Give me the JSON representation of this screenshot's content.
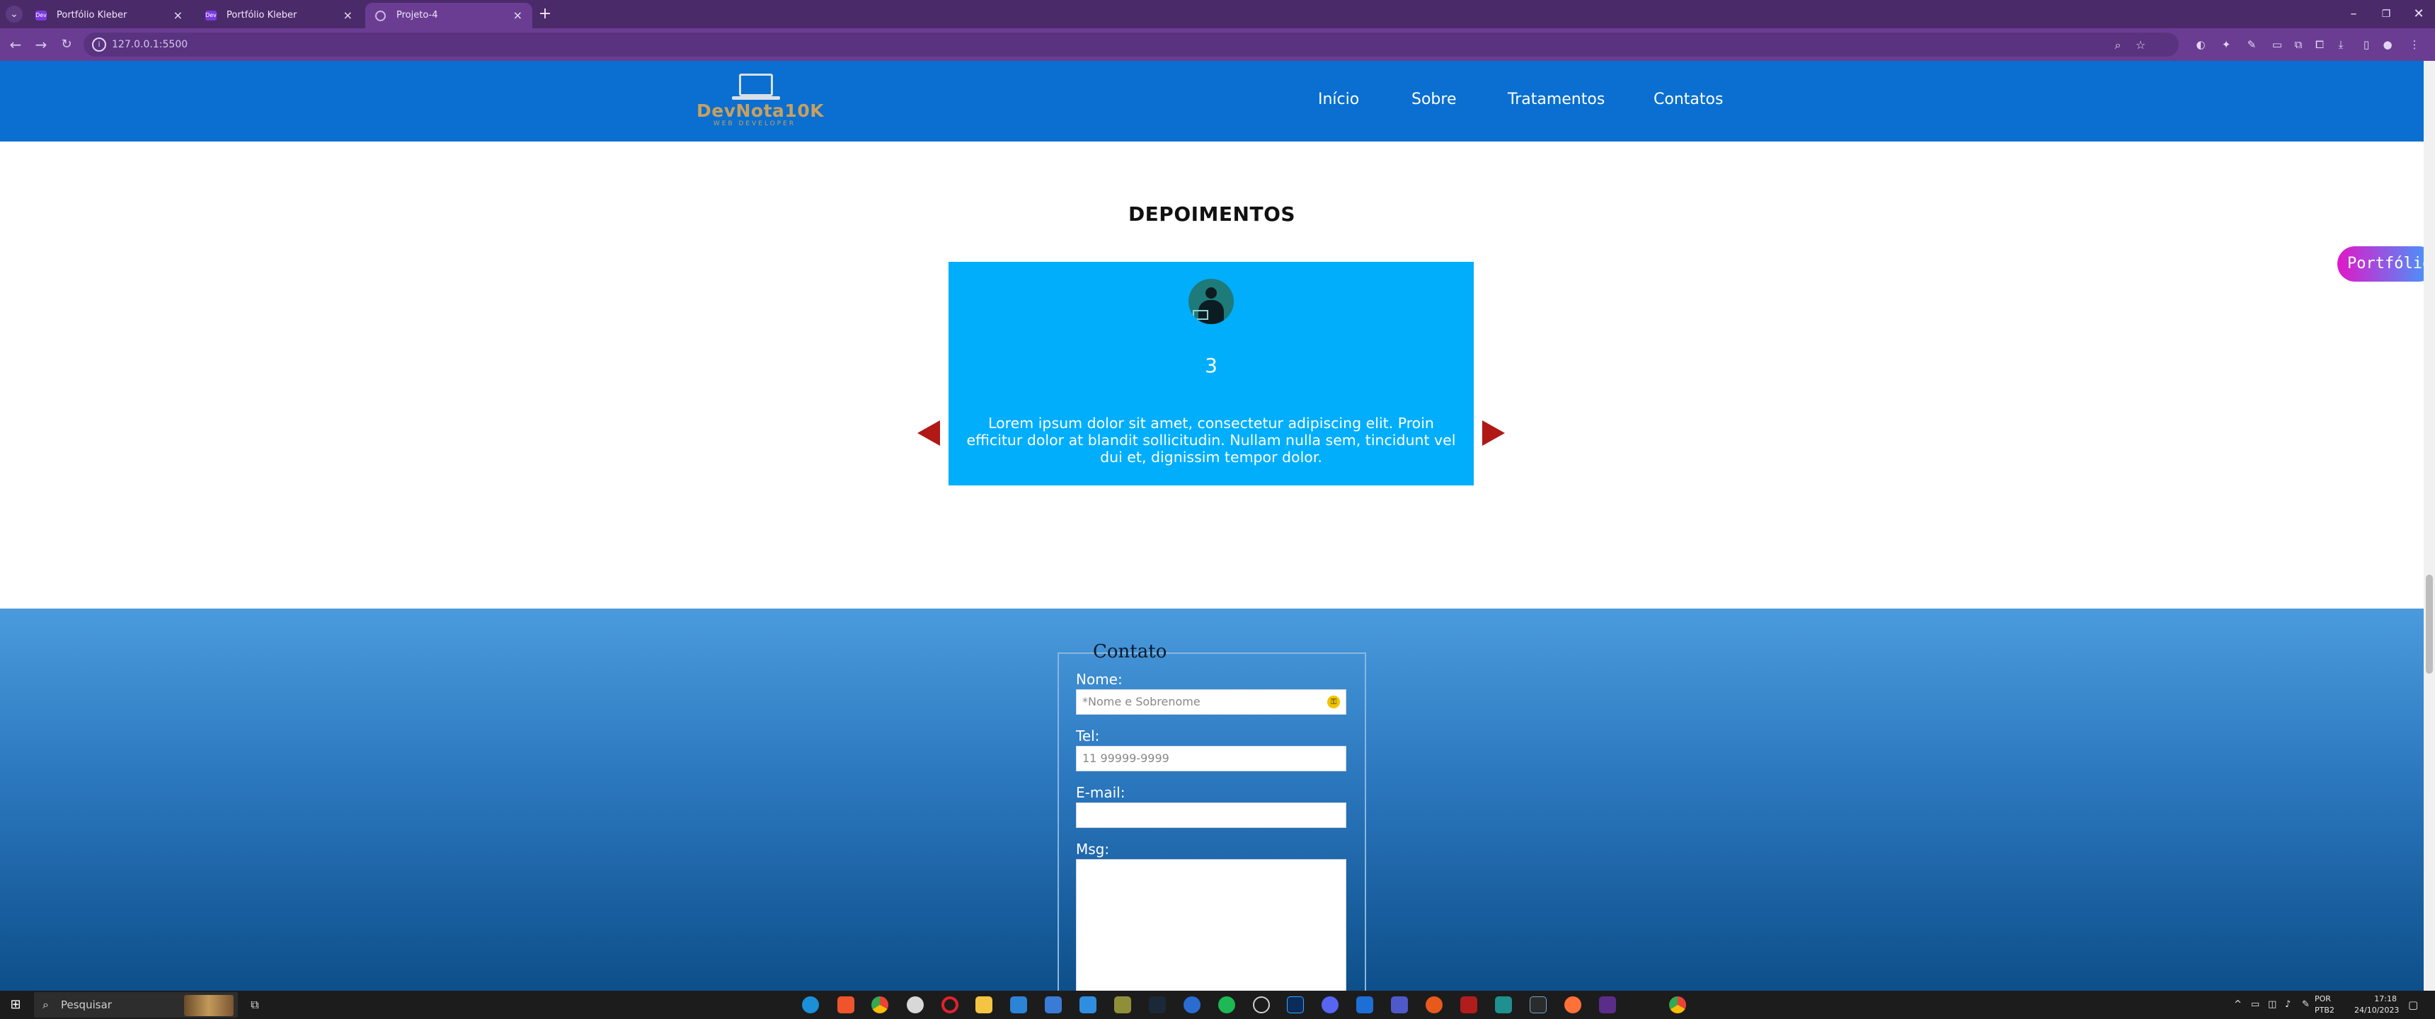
{
  "browser": {
    "tabs": [
      {
        "title": "Portfólio Kleber",
        "active": false
      },
      {
        "title": "Portfólio Kleber",
        "active": false
      },
      {
        "title": "Projeto-4",
        "active": true
      }
    ],
    "url": "127.0.0.1:5500"
  },
  "site": {
    "logo_text": "DevNota10K",
    "logo_tagline": "WEB DEVELOPER",
    "nav": [
      "Início",
      "Sobre",
      "Tratamentos",
      "Contatos"
    ]
  },
  "testimonials": {
    "title": "DEPOIMENTOS",
    "number": "3",
    "text": "Lorem ipsum dolor sit amet, consectetur adipiscing elit. Proin efficitur dolor at blandit sollicitudin. Nullam nulla sem, tincidunt vel dui et, dignissim tempor dolor.",
    "arrow_color": "#b01916",
    "card_color": "#00aefc"
  },
  "floating_button": {
    "label": "Portfólio"
  },
  "contact": {
    "legend": "Contato",
    "name_label": "Nome:",
    "name_placeholder": "*Nome e Sobrenome",
    "tel_label": "Tel:",
    "tel_placeholder": "11 99999-9999",
    "email_label": "E-mail:",
    "msg_label": "Msg:"
  },
  "taskbar": {
    "search_placeholder": "Pesquisar",
    "language": "POR",
    "keyboard": "PTB2",
    "time": "17:18",
    "date": "24/10/2023"
  },
  "colors": {
    "header": "#0a6fd0",
    "browser_frame": "#4b2a6a"
  }
}
